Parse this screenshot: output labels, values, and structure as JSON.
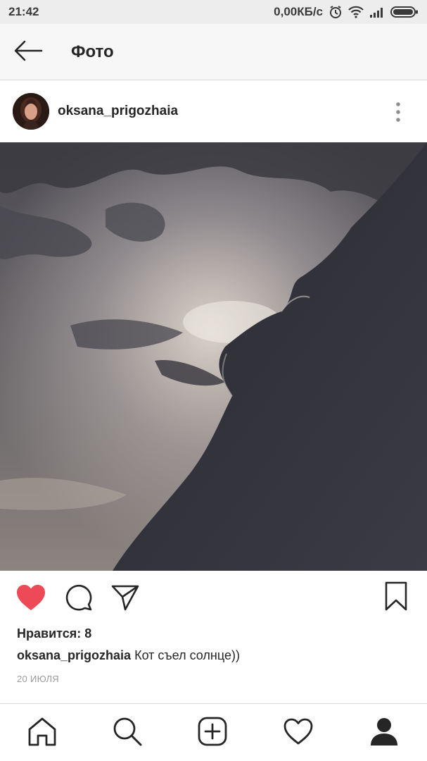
{
  "status_bar": {
    "time": "21:42",
    "network_speed": "0,00КБ/с",
    "icons": [
      "alarm-icon",
      "wifi-icon",
      "signal-icon",
      "battery-icon"
    ]
  },
  "header": {
    "title": "Фото",
    "back_icon": "arrow-left-icon"
  },
  "post": {
    "username": "oksana_prigozhaia",
    "more_icon": "vertical-dots-icon",
    "photo": "dark storm cloud covering the sun",
    "liked": true,
    "likes_text": "Нравится: 8",
    "caption_user": "oksana_prigozhaia",
    "caption_text": "Кот съел солнце))",
    "date": "20 ИЮЛЯ",
    "actions": [
      "heart-icon",
      "comment-icon",
      "share-icon",
      "bookmark-icon"
    ]
  },
  "bottom_nav": {
    "items": [
      "home-icon",
      "search-icon",
      "add-icon",
      "activity-heart-icon",
      "profile-icon"
    ]
  },
  "colors": {
    "like_red": "#ed4956",
    "status_bar_bg": "#ededed",
    "header_bg": "#f7f7f7",
    "date_gray": "#999999"
  }
}
